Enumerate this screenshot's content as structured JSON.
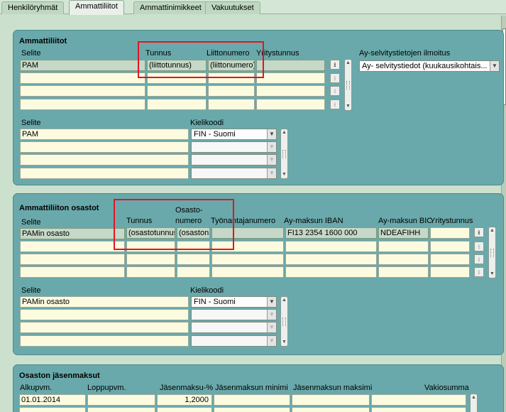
{
  "tabs": [
    {
      "label": "Henkilöryhmät"
    },
    {
      "label": "Ammattiliitot"
    },
    {
      "label": "Ammattinimikkeet"
    },
    {
      "label": "Vakuutukset"
    }
  ],
  "unions": {
    "title": "Ammattiliitot",
    "headers": {
      "selite": "Selite",
      "tunnus": "Tunnus",
      "liittonumero": "Liittonumero",
      "yritystunnus": "Yritystunnus"
    },
    "rows": [
      {
        "selite": "PAM",
        "tunnus": "(liittotunnus)",
        "liittonumero": "(liittonumero)",
        "yritystunnus": ""
      },
      {
        "selite": "",
        "tunnus": "",
        "liittonumero": "",
        "yritystunnus": ""
      },
      {
        "selite": "",
        "tunnus": "",
        "liittonumero": "",
        "yritystunnus": ""
      },
      {
        "selite": "",
        "tunnus": "",
        "liittonumero": "",
        "yritystunnus": ""
      }
    ],
    "report_label": "Ay-selvitystietojen ilmoitus",
    "report_value": "Ay- selvitystiedot (kuukausikohtais...",
    "lang_headers": {
      "selite": "Selite",
      "kielikoodi": "Kielikoodi"
    },
    "lang_rows": [
      {
        "selite": "PAM",
        "kielikoodi": "FIN - Suomi"
      },
      {
        "selite": "",
        "kielikoodi": ""
      },
      {
        "selite": "",
        "kielikoodi": ""
      },
      {
        "selite": "",
        "kielikoodi": ""
      }
    ]
  },
  "branches": {
    "title": "Ammattiliiton osastot",
    "headers": {
      "selite": "Selite",
      "tunnus": "Tunnus",
      "osastonumero_1": "Osasto-",
      "osastonumero_2": "numero",
      "tyonantajanumero": "Työnantajanumero",
      "iban": "Ay-maksun IBAN",
      "bic": "Ay-maksun BIC",
      "yritystunnus": "Yritystunnus"
    },
    "rows": [
      {
        "selite": "PAMin osasto",
        "tunnus": "(osastotunnus)",
        "osastonumero": "(osastonro)",
        "tyonantajanumero": "",
        "iban": "FI13 2354 1600 000",
        "bic": "NDEAFIHH",
        "yritystunnus": ""
      },
      {
        "selite": "",
        "tunnus": "",
        "osastonumero": "",
        "tyonantajanumero": "",
        "iban": "",
        "bic": "",
        "yritystunnus": ""
      },
      {
        "selite": "",
        "tunnus": "",
        "osastonumero": "",
        "tyonantajanumero": "",
        "iban": "",
        "bic": "",
        "yritystunnus": ""
      },
      {
        "selite": "",
        "tunnus": "",
        "osastonumero": "",
        "tyonantajanumero": "",
        "iban": "",
        "bic": "",
        "yritystunnus": ""
      }
    ],
    "lang_headers": {
      "selite": "Selite",
      "kielikoodi": "Kielikoodi"
    },
    "lang_rows": [
      {
        "selite": "PAMin osasto",
        "kielikoodi": "FIN - Suomi"
      },
      {
        "selite": "",
        "kielikoodi": ""
      },
      {
        "selite": "",
        "kielikoodi": ""
      },
      {
        "selite": "",
        "kielikoodi": ""
      }
    ]
  },
  "fees": {
    "title": "Osaston jäsenmaksut",
    "headers": {
      "alkupvm": "Alkupvm.",
      "loppupvm": "Loppupvm.",
      "jasenmaksu": "Jäsenmaksu-%",
      "minimi": "Jäsenmaksun minimi",
      "maksimi": "Jäsenmaksun maksimi",
      "vakiosumma": "Vakiosumma"
    },
    "rows": [
      {
        "alkupvm": "01.01.2014",
        "loppupvm": "",
        "jasenmaksu": "1,2000",
        "minimi": "",
        "maksimi": "",
        "vakiosumma": ""
      },
      {
        "alkupvm": "",
        "loppupvm": "",
        "jasenmaksu": "",
        "minimi": "",
        "maksimi": "",
        "vakiosumma": ""
      }
    ]
  },
  "icons": {
    "row_action": "download-arrow-icon",
    "dropdown": "chevron-down-icon",
    "scroll_up": "arrow-up-icon",
    "scroll_down": "arrow-down-icon"
  },
  "colors": {
    "panel": "#6aa9ab",
    "field": "#fdfbdf",
    "selected_row": "#c6d8c8",
    "highlight": "#e01525",
    "background": "#cbe0cd"
  }
}
